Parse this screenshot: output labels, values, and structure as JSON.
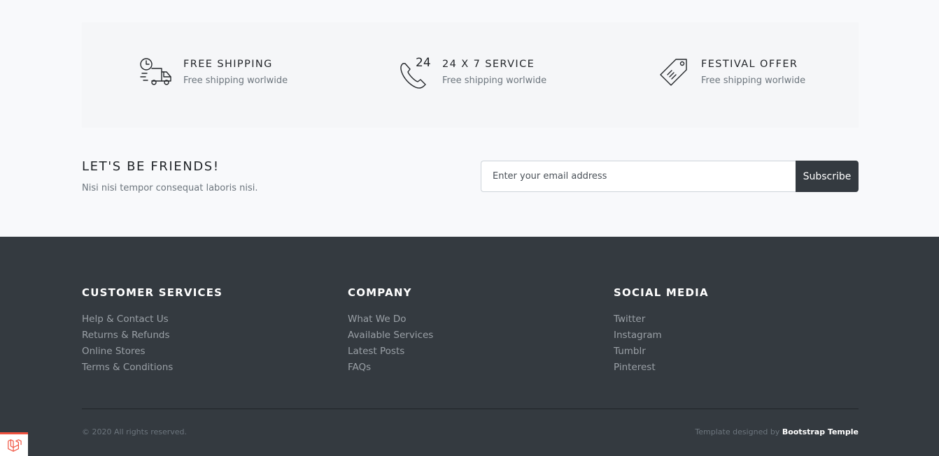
{
  "services": [
    {
      "icon": "delivery-truck-clock-icon",
      "title": "FREE SHIPPING",
      "subtitle": "Free shipping worlwide"
    },
    {
      "icon": "phone-24-icon",
      "title": "24 X 7 SERVICE",
      "subtitle": "Free shipping worlwide",
      "icon_text": "24"
    },
    {
      "icon": "price-tag-icon",
      "title": "FESTIVAL OFFER",
      "subtitle": "Free shipping worlwide"
    }
  ],
  "newsletter": {
    "title": "LET'S BE FRIENDS!",
    "subtitle": "Nisi nisi tempor consequat laboris nisi.",
    "placeholder": "Enter your email address",
    "button_label": "Subscribe"
  },
  "footer": {
    "columns": [
      {
        "heading": "CUSTOMER SERVICES",
        "links": [
          "Help & Contact Us",
          "Returns & Refunds",
          "Online Stores",
          "Terms & Conditions"
        ]
      },
      {
        "heading": "COMPANY",
        "links": [
          "What We Do",
          "Available Services",
          "Latest Posts",
          "FAQs"
        ]
      },
      {
        "heading": "SOCIAL MEDIA",
        "links": [
          "Twitter",
          "Instagram",
          "Tumblr",
          "Pinterest"
        ]
      }
    ],
    "copyright": "© 2020 All rights reserved.",
    "credit_prefix": "Template designed by",
    "credit_link": "Bootstrap Temple"
  },
  "colors": {
    "page_background": "#f8f9fb",
    "footer_background": "#343a40",
    "subscribe_button": "#343a40",
    "badge_accent": "#f05340"
  },
  "badge": {
    "icon": "laravel-logo-icon"
  }
}
